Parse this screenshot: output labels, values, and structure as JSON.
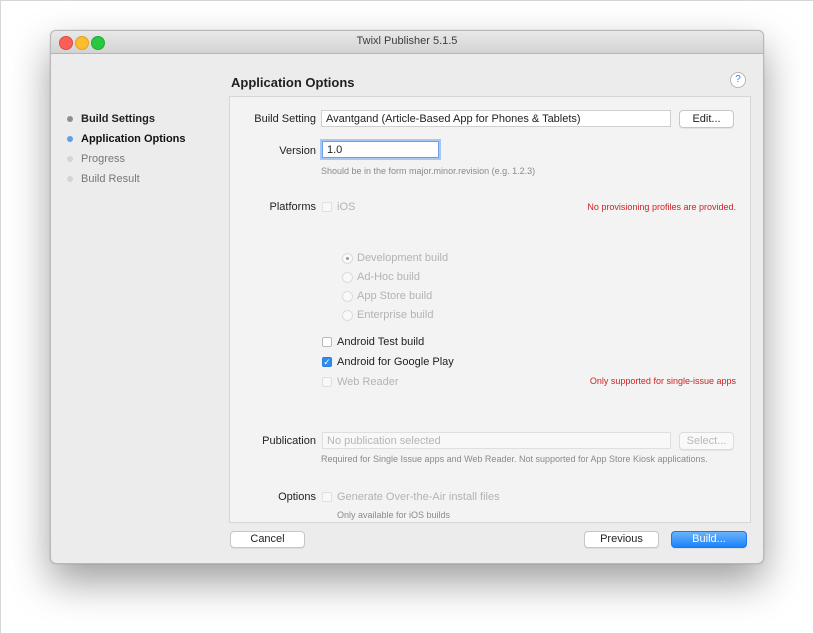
{
  "window": {
    "title": "Twixl Publisher 5.1.5"
  },
  "steps": [
    {
      "label": "Build Settings",
      "state": "done"
    },
    {
      "label": "Application Options",
      "state": "active"
    },
    {
      "label": "Progress",
      "state": "pending"
    },
    {
      "label": "Build Result",
      "state": "pending"
    }
  ],
  "page": {
    "heading": "Application Options",
    "help": "?"
  },
  "build_setting": {
    "label": "Build Setting",
    "value": "Avantgand (Article-Based App for Phones & Tablets)",
    "edit_button": "Edit..."
  },
  "version": {
    "label": "Version",
    "value": "1.0",
    "hint": "Should be in the form major.minor.revision (e.g. 1.2.3)"
  },
  "platforms": {
    "label": "Platforms",
    "ios": {
      "label": "iOS",
      "checked": false,
      "enabled": false
    },
    "ios_warning": "No provisioning profiles are provided.",
    "ios_builds": [
      {
        "label": "Development build",
        "selected": true
      },
      {
        "label": "Ad-Hoc build",
        "selected": false
      },
      {
        "label": "App Store build",
        "selected": false
      },
      {
        "label": "Enterprise build",
        "selected": false
      }
    ],
    "android_test": {
      "label": "Android Test build",
      "checked": false
    },
    "android_play": {
      "label": "Android for Google Play",
      "checked": true
    },
    "web_reader": {
      "label": "Web Reader",
      "checked": false,
      "enabled": false
    },
    "web_reader_warning": "Only supported for single-issue apps"
  },
  "publication": {
    "label": "Publication",
    "placeholder": "No publication selected",
    "select_button": "Select...",
    "hint": "Required for Single Issue apps and Web Reader. Not supported for App Store Kiosk applications."
  },
  "options": {
    "label": "Options",
    "ota": {
      "label": "Generate Over-the-Air install files",
      "checked": false,
      "enabled": false
    },
    "hint": "Only available for iOS builds"
  },
  "footer": {
    "cancel": "Cancel",
    "previous": "Previous",
    "build": "Build..."
  },
  "colors": {
    "accent": "#2f8cf4",
    "warning": "#d12020",
    "active_step_dot": "#5aa0ea"
  }
}
